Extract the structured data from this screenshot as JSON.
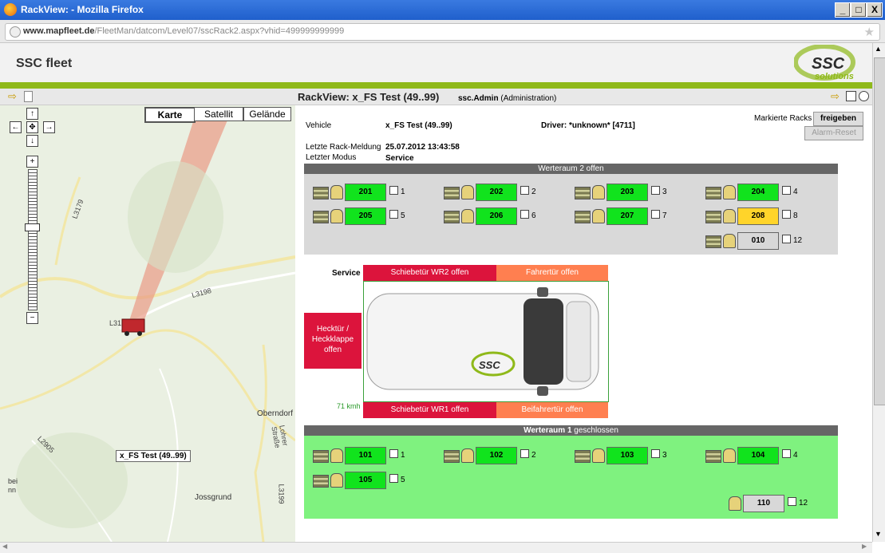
{
  "window": {
    "title": "RackView: - Mozilla Firefox",
    "minimize": "_",
    "maximize": "□",
    "close": "X"
  },
  "urlbar": {
    "domain": "www.mapfleet.de",
    "path": "/FleetMan/datcom/Level07/sscRack2.aspx?vhid=499999999999",
    "pre": ""
  },
  "header": {
    "brand": "SSC fleet",
    "logo_text": "SSC",
    "logo_sub": "solutions"
  },
  "toolbar": {
    "title": "RackView: x_FS Test (49..99)",
    "user": "ssc.Admin",
    "role": "(Administration)"
  },
  "map": {
    "tabs": [
      "Karte",
      "Satellit",
      "Gelände"
    ],
    "labels": {
      "l3179": "L3179",
      "l3198": "L3198",
      "l31": "L31",
      "l2905": "L2905",
      "oberndorf": "Oberndorf",
      "lohrer": "Lohrer Straße",
      "jossgrund": "Jossgrund",
      "l3199": "L3199",
      "bei": "bei",
      "nn": "nn"
    },
    "vehicle_label": "x_FS Test (49..99)"
  },
  "info": {
    "vehicle_label": "Vehicle",
    "vehicle_value": "x_FS Test (49..99)",
    "driver_label": "Driver:",
    "driver_value": "*unknown* [4711]",
    "last_msg_label": "Letzte Rack-Meldung",
    "last_msg_value": "25.07.2012 13:43:58",
    "last_mode_label": "Letzter Modus",
    "last_mode_value": "Service",
    "marked_racks": "Markierte Racks",
    "release_btn": "freigeben",
    "alarm_btn": "Alarm-Reset"
  },
  "room2": {
    "title_bold": "Werteraum 2",
    "title_state": "offen",
    "slots": [
      {
        "id": "201",
        "n": "1",
        "color": "green"
      },
      {
        "id": "202",
        "n": "2",
        "color": "green"
      },
      {
        "id": "203",
        "n": "3",
        "color": "green"
      },
      {
        "id": "204",
        "n": "4",
        "color": "green"
      },
      {
        "id": "205",
        "n": "5",
        "color": "green"
      },
      {
        "id": "206",
        "n": "6",
        "color": "green"
      },
      {
        "id": "207",
        "n": "7",
        "color": "green"
      },
      {
        "id": "208",
        "n": "8",
        "color": "yellow"
      },
      {
        "id": "010",
        "n": "12",
        "color": "grey"
      }
    ]
  },
  "van": {
    "mode": "Service",
    "door_wr2": "Schiebetür WR2 offen",
    "door_driver": "Fahrertür offen",
    "door_rear": "Hecktür / Heckklappe offen",
    "door_wr1": "Schiebetür WR1 offen",
    "door_passenger": "Beifahrertür offen",
    "speed": "71 kmh"
  },
  "room1": {
    "title_bold": "Werteraum 1",
    "title_state": "geschlossen",
    "slots": [
      {
        "id": "101",
        "n": "1",
        "color": "green"
      },
      {
        "id": "102",
        "n": "2",
        "color": "green"
      },
      {
        "id": "103",
        "n": "3",
        "color": "green"
      },
      {
        "id": "104",
        "n": "4",
        "color": "green"
      },
      {
        "id": "105",
        "n": "5",
        "color": "green"
      },
      {
        "id": "110",
        "n": "12",
        "color": "grey"
      }
    ]
  },
  "colors": {
    "green": "#11e31d",
    "yellow": "#ffd42a",
    "grey": "#d8d8d8",
    "door_red": "#dc143c",
    "door_orange": "#ff7f50",
    "room1_bg": "#7ff27f",
    "accent": "#8fb91a"
  }
}
